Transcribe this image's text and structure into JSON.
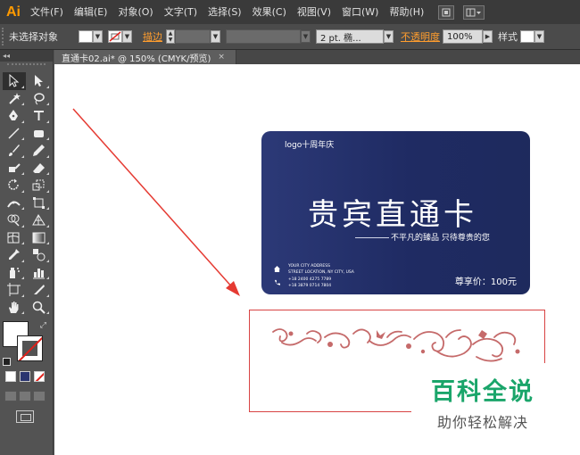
{
  "app": {
    "logo": "Ai"
  },
  "menu": [
    "文件(F)",
    "编辑(E)",
    "对象(O)",
    "文字(T)",
    "选择(S)",
    "效果(C)",
    "视图(V)",
    "窗口(W)",
    "帮助(H)"
  ],
  "control_bar": {
    "selection": "未选择对象",
    "stroke_label": "描边",
    "weight_value": "2 pt. 椭...",
    "opacity_label": "不透明度",
    "opacity_value": "100%",
    "style_label": "样式"
  },
  "toolbox": {
    "header": "◂◂"
  },
  "tab": {
    "title": "直通卡02.ai* @ 150% (CMYK/预览)",
    "close": "×"
  },
  "card": {
    "logo_text": "logo十周年庆",
    "title": "贵宾直通卡",
    "slogan": "不平凡的臻品 只待尊贵的您",
    "address": [
      "YOUR CITY ADDRESS",
      "STREET LOCATION, NY CITY, USA"
    ],
    "phones": [
      "+18 2400 4275 7789",
      "+18 3879 0714 7804"
    ],
    "price": "尊享价：100元"
  },
  "watermark": {
    "title": "百科全说",
    "subtitle": "助你轻松解决"
  },
  "colors": {
    "card_navy": "#1f2b63",
    "ornament": "#c56a6a",
    "arrow": "#e53a32",
    "frame": "#d84343",
    "watermark_green": "#1aa56a",
    "menu_accent": "#ff9a00"
  }
}
